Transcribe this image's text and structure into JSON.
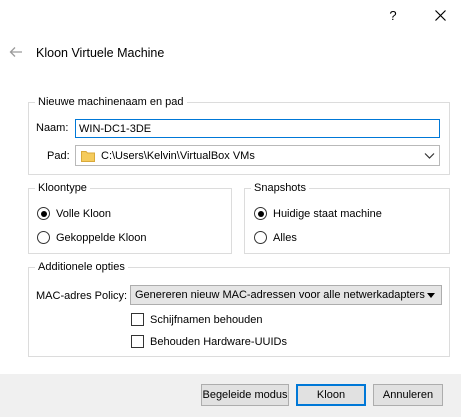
{
  "window": {
    "title": "Kloon Virtuele Machine",
    "help_glyph": "?"
  },
  "name_path": {
    "legend": "Nieuwe machinenaam en pad",
    "name_label": "Naam:",
    "name_value": "WIN-DC1-3DE",
    "path_label": "Pad:",
    "path_value": "C:\\Users\\Kelvin\\VirtualBox VMs"
  },
  "clone_type": {
    "legend": "Kloontype",
    "options": [
      {
        "label": "Volle Kloon",
        "checked": true
      },
      {
        "label": "Gekoppelde Kloon",
        "checked": false
      }
    ]
  },
  "snapshots": {
    "legend": "Snapshots",
    "options": [
      {
        "label": "Huidige staat machine",
        "checked": true
      },
      {
        "label": "Alles",
        "checked": false
      }
    ]
  },
  "additional": {
    "legend": "Additionele opties",
    "mac_label": "MAC-adres Policy:",
    "mac_value": "Genereren nieuw MAC-adressen voor alle netwerkadapters",
    "keep_disk_names": "Schijfnamen behouden",
    "keep_hw_uuids": "Behouden Hardware-UUIDs"
  },
  "buttons": {
    "guided": "Begeleide modus",
    "clone": "Kloon",
    "cancel": "Annuleren"
  },
  "colors": {
    "accent": "#0078d7",
    "footer": "#f0f0f0"
  }
}
